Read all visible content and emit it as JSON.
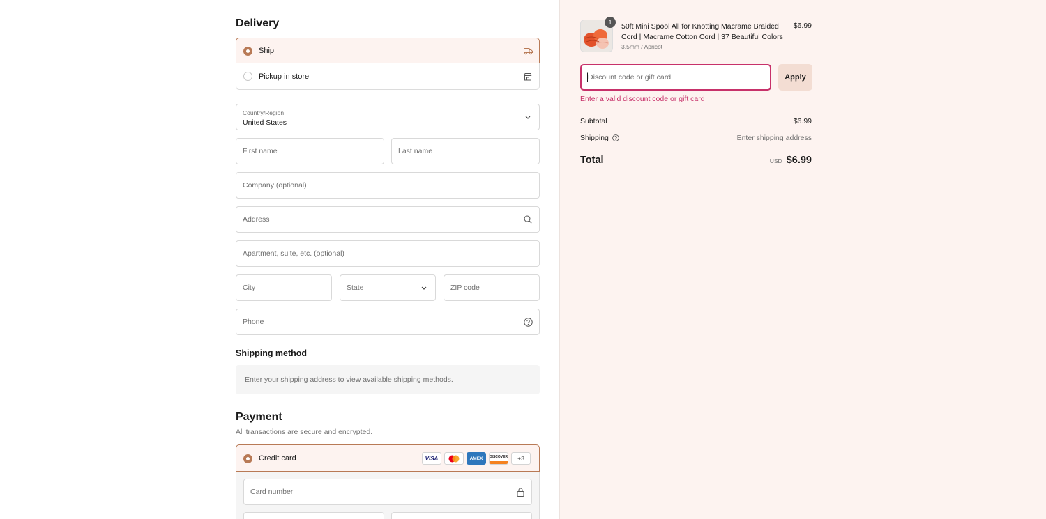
{
  "delivery": {
    "title": "Delivery",
    "options": [
      {
        "label": "Ship",
        "selected": true,
        "icon": "truck-icon"
      },
      {
        "label": "Pickup in store",
        "selected": false,
        "icon": "store-icon"
      }
    ]
  },
  "address_form": {
    "country_label": "Country/Region",
    "country_value": "United States",
    "first_name": "First name",
    "last_name": "Last name",
    "company": "Company (optional)",
    "address": "Address",
    "apartment": "Apartment, suite, etc. (optional)",
    "city": "City",
    "state": "State",
    "zip": "ZIP code",
    "phone": "Phone"
  },
  "shipping_method": {
    "title": "Shipping method",
    "message": "Enter your shipping address to view available shipping methods."
  },
  "payment": {
    "title": "Payment",
    "subtitle": "All transactions are secure and encrypted.",
    "method_label": "Credit card",
    "card_logos": [
      "VISA",
      "MC",
      "AMEX",
      "DISCOVER"
    ],
    "more_cards": "+3",
    "card_number": "Card number"
  },
  "summary": {
    "item": {
      "quantity": "1",
      "name": "50ft Mini Spool All for Knotting Macrame Braided Cord | Macrame Cotton Cord | 37 Beautiful Colors",
      "variant": "3.5mm / Apricot",
      "price": "$6.99"
    },
    "discount_placeholder": "Discount code or gift card",
    "apply_label": "Apply",
    "error": "Enter a valid discount code or gift card",
    "subtotal_label": "Subtotal",
    "subtotal_value": "$6.99",
    "shipping_label": "Shipping",
    "shipping_value": "Enter shipping address",
    "total_label": "Total",
    "currency": "USD",
    "total_value": "$6.99"
  },
  "colors": {
    "accent": "#b87a56",
    "error": "#c7316a",
    "summary_bg": "#fdf3f0"
  }
}
